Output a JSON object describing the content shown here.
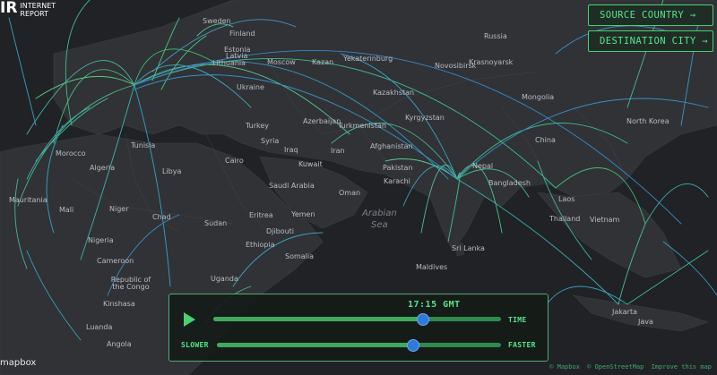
{
  "brand": {
    "logo_text": "IR",
    "subtitle_line1": "INTERNET",
    "subtitle_line2": "REPORT"
  },
  "buttons": {
    "source_country": "SOURCE COUNTRY →",
    "destination_city": "DESTINATION CITY →"
  },
  "controls": {
    "clock": "17:15 GMT",
    "time_label": "TIME",
    "slower_label": "SLOWER",
    "faster_label": "FASTER",
    "time_progress": 0.73,
    "speed_progress": 0.69
  },
  "map_labels": [
    {
      "t": "Sweden"
    },
    {
      "t": "Finland"
    },
    {
      "t": "Russia"
    },
    {
      "t": "Estonia"
    },
    {
      "t": "Latvia"
    },
    {
      "t": "Lithuania"
    },
    {
      "t": "Moscow"
    },
    {
      "t": "Kazan"
    },
    {
      "t": "Yekaterinburg"
    },
    {
      "t": "Novosibirsk"
    },
    {
      "t": "Krasnoyarsk"
    },
    {
      "t": "Ukraine"
    },
    {
      "t": "Kazakhstan"
    },
    {
      "t": "Mongolia"
    },
    {
      "t": "Kyrgyzstan"
    },
    {
      "t": "Turkey"
    },
    {
      "t": "Azerbaijan"
    },
    {
      "t": "Turkmenistan"
    },
    {
      "t": "North Korea"
    },
    {
      "t": "Syria"
    },
    {
      "t": "Iraq"
    },
    {
      "t": "Iran"
    },
    {
      "t": "Afghanistan"
    },
    {
      "t": "China"
    },
    {
      "t": "Tunisia"
    },
    {
      "t": "Kuwait"
    },
    {
      "t": "Pakistan"
    },
    {
      "t": "Nepal"
    },
    {
      "t": "Morocco"
    },
    {
      "t": "Algeria"
    },
    {
      "t": "Libya"
    },
    {
      "t": "Cairo"
    },
    {
      "t": "Karachi"
    },
    {
      "t": "Bangladesh"
    },
    {
      "t": "Saudi Arabia"
    },
    {
      "t": "Oman"
    },
    {
      "t": "Mauritania"
    },
    {
      "t": "Mali"
    },
    {
      "t": "Niger"
    },
    {
      "t": "Chad"
    },
    {
      "t": "Sudan"
    },
    {
      "t": "Eritrea"
    },
    {
      "t": "Yemen"
    },
    {
      "t": "Laos"
    },
    {
      "t": "Thailand"
    },
    {
      "t": "Vietnam"
    },
    {
      "t": "Djibouti"
    },
    {
      "t": "Nigeria"
    },
    {
      "t": "Ethiopia"
    },
    {
      "t": "Sri Lanka"
    },
    {
      "t": "Cameroon"
    },
    {
      "t": "Somalia"
    },
    {
      "t": "Maldives"
    },
    {
      "t": "Republic of the Congo"
    },
    {
      "t": "Uganda"
    },
    {
      "t": "Kinshasa"
    },
    {
      "t": "Luanda"
    },
    {
      "t": "Angola"
    },
    {
      "t": "Jakarta"
    },
    {
      "t": "Java"
    }
  ],
  "ocean_label": {
    "line1": "Arabian",
    "line2": "Sea"
  },
  "footer": {
    "mapbox": "mapbox",
    "attribution": [
      "© Mapbox",
      "© OpenStreetMap",
      "Improve this map"
    ]
  }
}
